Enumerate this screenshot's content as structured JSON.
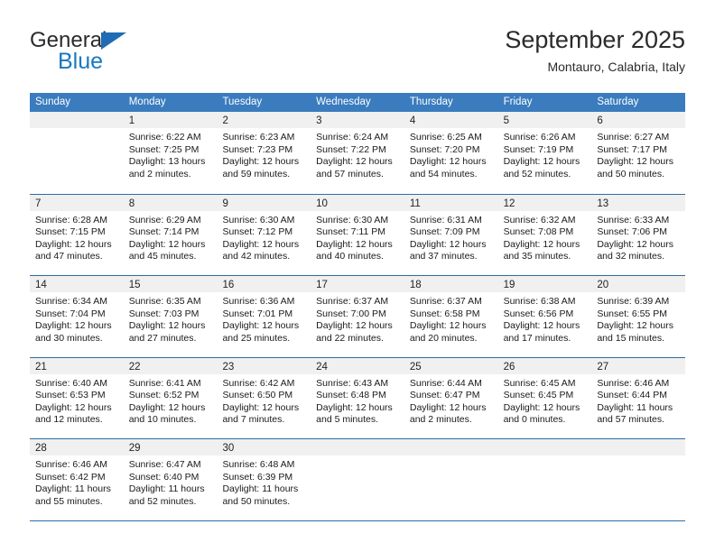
{
  "brand": {
    "name_top": "General",
    "name_bottom": "Blue",
    "accent_color": "#1678c2",
    "triangle_color": "#1f6cb4"
  },
  "header": {
    "title": "September 2025",
    "subtitle": "Montauro, Calabria, Italy"
  },
  "theme": {
    "header_bar_color": "#3a7cbe",
    "row_divider_color": "#2e6da4",
    "date_band_color": "#f0f0f0",
    "text_color": "#1a1a1a"
  },
  "weekdays": [
    "Sunday",
    "Monday",
    "Tuesday",
    "Wednesday",
    "Thursday",
    "Friday",
    "Saturday"
  ],
  "weeks": [
    [
      {
        "date": "",
        "sunrise": "",
        "sunset": "",
        "daylight_line1": "",
        "daylight_line2": ""
      },
      {
        "date": "1",
        "sunrise": "Sunrise: 6:22 AM",
        "sunset": "Sunset: 7:25 PM",
        "daylight_line1": "Daylight: 13 hours",
        "daylight_line2": "and 2 minutes."
      },
      {
        "date": "2",
        "sunrise": "Sunrise: 6:23 AM",
        "sunset": "Sunset: 7:23 PM",
        "daylight_line1": "Daylight: 12 hours",
        "daylight_line2": "and 59 minutes."
      },
      {
        "date": "3",
        "sunrise": "Sunrise: 6:24 AM",
        "sunset": "Sunset: 7:22 PM",
        "daylight_line1": "Daylight: 12 hours",
        "daylight_line2": "and 57 minutes."
      },
      {
        "date": "4",
        "sunrise": "Sunrise: 6:25 AM",
        "sunset": "Sunset: 7:20 PM",
        "daylight_line1": "Daylight: 12 hours",
        "daylight_line2": "and 54 minutes."
      },
      {
        "date": "5",
        "sunrise": "Sunrise: 6:26 AM",
        "sunset": "Sunset: 7:19 PM",
        "daylight_line1": "Daylight: 12 hours",
        "daylight_line2": "and 52 minutes."
      },
      {
        "date": "6",
        "sunrise": "Sunrise: 6:27 AM",
        "sunset": "Sunset: 7:17 PM",
        "daylight_line1": "Daylight: 12 hours",
        "daylight_line2": "and 50 minutes."
      }
    ],
    [
      {
        "date": "7",
        "sunrise": "Sunrise: 6:28 AM",
        "sunset": "Sunset: 7:15 PM",
        "daylight_line1": "Daylight: 12 hours",
        "daylight_line2": "and 47 minutes."
      },
      {
        "date": "8",
        "sunrise": "Sunrise: 6:29 AM",
        "sunset": "Sunset: 7:14 PM",
        "daylight_line1": "Daylight: 12 hours",
        "daylight_line2": "and 45 minutes."
      },
      {
        "date": "9",
        "sunrise": "Sunrise: 6:30 AM",
        "sunset": "Sunset: 7:12 PM",
        "daylight_line1": "Daylight: 12 hours",
        "daylight_line2": "and 42 minutes."
      },
      {
        "date": "10",
        "sunrise": "Sunrise: 6:30 AM",
        "sunset": "Sunset: 7:11 PM",
        "daylight_line1": "Daylight: 12 hours",
        "daylight_line2": "and 40 minutes."
      },
      {
        "date": "11",
        "sunrise": "Sunrise: 6:31 AM",
        "sunset": "Sunset: 7:09 PM",
        "daylight_line1": "Daylight: 12 hours",
        "daylight_line2": "and 37 minutes."
      },
      {
        "date": "12",
        "sunrise": "Sunrise: 6:32 AM",
        "sunset": "Sunset: 7:08 PM",
        "daylight_line1": "Daylight: 12 hours",
        "daylight_line2": "and 35 minutes."
      },
      {
        "date": "13",
        "sunrise": "Sunrise: 6:33 AM",
        "sunset": "Sunset: 7:06 PM",
        "daylight_line1": "Daylight: 12 hours",
        "daylight_line2": "and 32 minutes."
      }
    ],
    [
      {
        "date": "14",
        "sunrise": "Sunrise: 6:34 AM",
        "sunset": "Sunset: 7:04 PM",
        "daylight_line1": "Daylight: 12 hours",
        "daylight_line2": "and 30 minutes."
      },
      {
        "date": "15",
        "sunrise": "Sunrise: 6:35 AM",
        "sunset": "Sunset: 7:03 PM",
        "daylight_line1": "Daylight: 12 hours",
        "daylight_line2": "and 27 minutes."
      },
      {
        "date": "16",
        "sunrise": "Sunrise: 6:36 AM",
        "sunset": "Sunset: 7:01 PM",
        "daylight_line1": "Daylight: 12 hours",
        "daylight_line2": "and 25 minutes."
      },
      {
        "date": "17",
        "sunrise": "Sunrise: 6:37 AM",
        "sunset": "Sunset: 7:00 PM",
        "daylight_line1": "Daylight: 12 hours",
        "daylight_line2": "and 22 minutes."
      },
      {
        "date": "18",
        "sunrise": "Sunrise: 6:37 AM",
        "sunset": "Sunset: 6:58 PM",
        "daylight_line1": "Daylight: 12 hours",
        "daylight_line2": "and 20 minutes."
      },
      {
        "date": "19",
        "sunrise": "Sunrise: 6:38 AM",
        "sunset": "Sunset: 6:56 PM",
        "daylight_line1": "Daylight: 12 hours",
        "daylight_line2": "and 17 minutes."
      },
      {
        "date": "20",
        "sunrise": "Sunrise: 6:39 AM",
        "sunset": "Sunset: 6:55 PM",
        "daylight_line1": "Daylight: 12 hours",
        "daylight_line2": "and 15 minutes."
      }
    ],
    [
      {
        "date": "21",
        "sunrise": "Sunrise: 6:40 AM",
        "sunset": "Sunset: 6:53 PM",
        "daylight_line1": "Daylight: 12 hours",
        "daylight_line2": "and 12 minutes."
      },
      {
        "date": "22",
        "sunrise": "Sunrise: 6:41 AM",
        "sunset": "Sunset: 6:52 PM",
        "daylight_line1": "Daylight: 12 hours",
        "daylight_line2": "and 10 minutes."
      },
      {
        "date": "23",
        "sunrise": "Sunrise: 6:42 AM",
        "sunset": "Sunset: 6:50 PM",
        "daylight_line1": "Daylight: 12 hours",
        "daylight_line2": "and 7 minutes."
      },
      {
        "date": "24",
        "sunrise": "Sunrise: 6:43 AM",
        "sunset": "Sunset: 6:48 PM",
        "daylight_line1": "Daylight: 12 hours",
        "daylight_line2": "and 5 minutes."
      },
      {
        "date": "25",
        "sunrise": "Sunrise: 6:44 AM",
        "sunset": "Sunset: 6:47 PM",
        "daylight_line1": "Daylight: 12 hours",
        "daylight_line2": "and 2 minutes."
      },
      {
        "date": "26",
        "sunrise": "Sunrise: 6:45 AM",
        "sunset": "Sunset: 6:45 PM",
        "daylight_line1": "Daylight: 12 hours",
        "daylight_line2": "and 0 minutes."
      },
      {
        "date": "27",
        "sunrise": "Sunrise: 6:46 AM",
        "sunset": "Sunset: 6:44 PM",
        "daylight_line1": "Daylight: 11 hours",
        "daylight_line2": "and 57 minutes."
      }
    ],
    [
      {
        "date": "28",
        "sunrise": "Sunrise: 6:46 AM",
        "sunset": "Sunset: 6:42 PM",
        "daylight_line1": "Daylight: 11 hours",
        "daylight_line2": "and 55 minutes."
      },
      {
        "date": "29",
        "sunrise": "Sunrise: 6:47 AM",
        "sunset": "Sunset: 6:40 PM",
        "daylight_line1": "Daylight: 11 hours",
        "daylight_line2": "and 52 minutes."
      },
      {
        "date": "30",
        "sunrise": "Sunrise: 6:48 AM",
        "sunset": "Sunset: 6:39 PM",
        "daylight_line1": "Daylight: 11 hours",
        "daylight_line2": "and 50 minutes."
      },
      {
        "date": "",
        "sunrise": "",
        "sunset": "",
        "daylight_line1": "",
        "daylight_line2": ""
      },
      {
        "date": "",
        "sunrise": "",
        "sunset": "",
        "daylight_line1": "",
        "daylight_line2": ""
      },
      {
        "date": "",
        "sunrise": "",
        "sunset": "",
        "daylight_line1": "",
        "daylight_line2": ""
      },
      {
        "date": "",
        "sunrise": "",
        "sunset": "",
        "daylight_line1": "",
        "daylight_line2": ""
      }
    ]
  ]
}
